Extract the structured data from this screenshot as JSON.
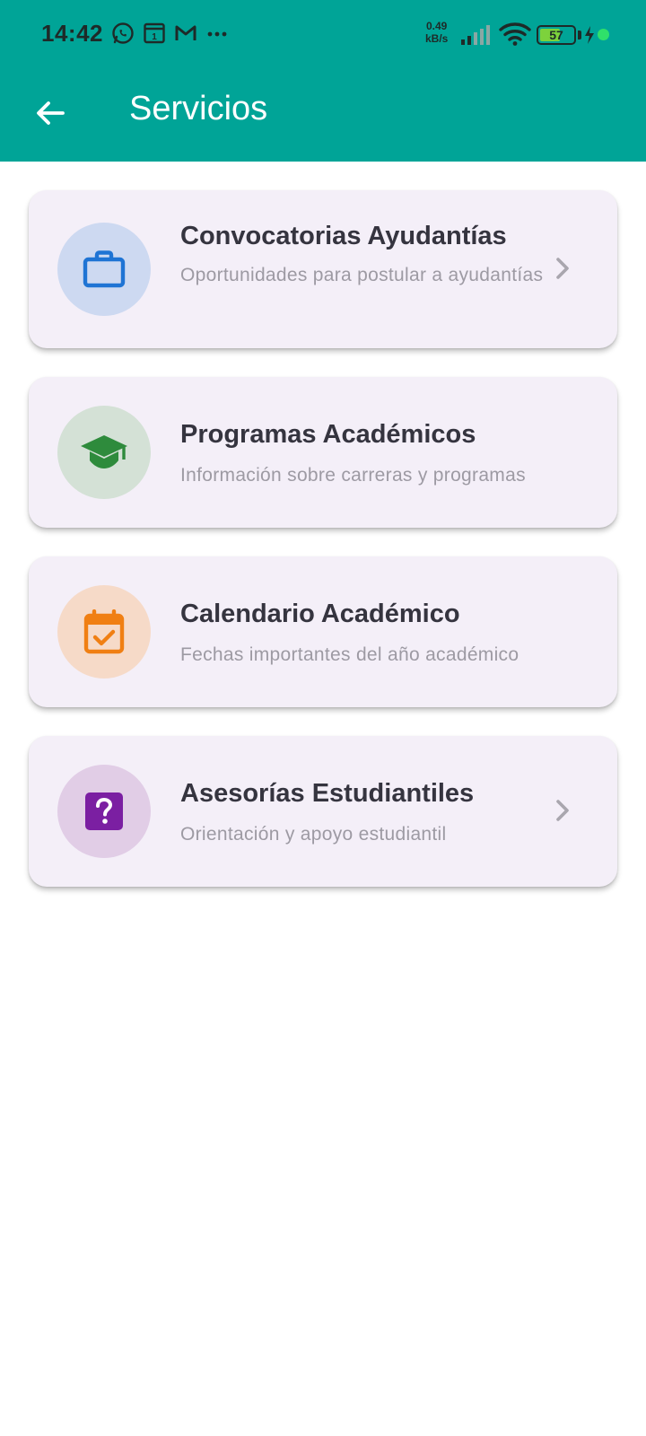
{
  "status_bar": {
    "time": "14:42",
    "net_speed_value": "0.49",
    "net_speed_unit": "kB/s",
    "battery_level": "57",
    "icons": [
      "whatsapp-icon",
      "calendar-app-icon",
      "gmail-icon",
      "more-dots-icon",
      "signal-icon",
      "wifi-icon",
      "battery-icon",
      "charging-icon"
    ]
  },
  "app_bar": {
    "title": "Servicios",
    "back_icon": "arrow-back-icon",
    "color": "#00a497"
  },
  "services": [
    {
      "title": "Convocatorias Ayudantías",
      "subtitle": "Oportunidades para postular a ayudantías",
      "icon": "briefcase-icon",
      "icon_color": "#1f74d4",
      "circle_color": "#cdd9f1",
      "has_chevron": true
    },
    {
      "title": "Programas Académicos",
      "subtitle": "Información sobre carreras y programas",
      "icon": "graduation-cap-icon",
      "icon_color": "#2e8b3c",
      "circle_color": "#d4e1d6",
      "has_chevron": false
    },
    {
      "title": "Calendario Académico",
      "subtitle": "Fechas importantes del año académico",
      "icon": "calendar-check-icon",
      "icon_color": "#f07f13",
      "circle_color": "#f6dac8",
      "has_chevron": false
    },
    {
      "title": "Asesorías Estudiantiles",
      "subtitle": "Orientación y apoyo estudiantil",
      "icon": "help-question-icon",
      "icon_color": "#7b1fa2",
      "circle_color": "#e1cde6",
      "has_chevron": true
    }
  ]
}
